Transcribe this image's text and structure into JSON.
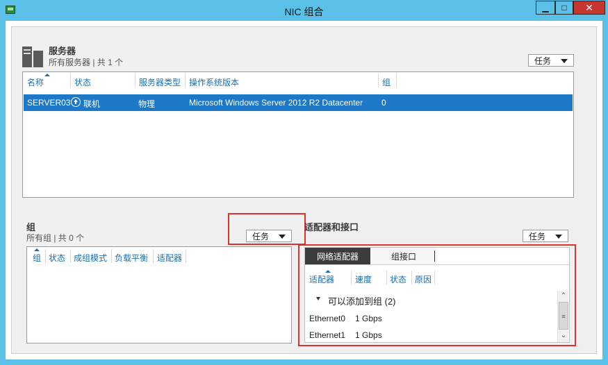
{
  "window": {
    "title": "NIC 组合",
    "min_glyph": "▁",
    "max_glyph": "□",
    "close_glyph": "✕"
  },
  "servers": {
    "title": "服务器",
    "subtitle": "所有服务器 | 共 1 个",
    "tasks_label": "任务",
    "columns": [
      "名称",
      "状态",
      "服务器类型",
      "操作系统版本",
      "组"
    ],
    "rows": [
      {
        "name": "SERVER03",
        "status": "联机",
        "type": "物理",
        "os": "Microsoft Windows Server 2012 R2 Datacenter",
        "group": "0"
      }
    ]
  },
  "groups": {
    "title": "组",
    "subtitle": "所有组 | 共 0 个",
    "tasks_label": "任务",
    "columns": [
      "组",
      "状态",
      "成组模式",
      "负载平衡",
      "适配器"
    ]
  },
  "adapters": {
    "title": "适配器和接口",
    "tasks_label": "任务",
    "tabs": [
      "网络适配器",
      "组接口"
    ],
    "columns": [
      "适配器",
      "速度",
      "状态",
      "原因"
    ],
    "group_header": "可以添加到组 (2)",
    "rows": [
      {
        "name": "Ethernet0",
        "speed": "1 Gbps"
      },
      {
        "name": "Ethernet1",
        "speed": "1 Gbps"
      }
    ]
  },
  "colors": {
    "titlebar": "#5bc0e8",
    "selection": "#1e78c8",
    "highlight_red": "#e0312f",
    "link_blue": "#1a6fb0"
  }
}
